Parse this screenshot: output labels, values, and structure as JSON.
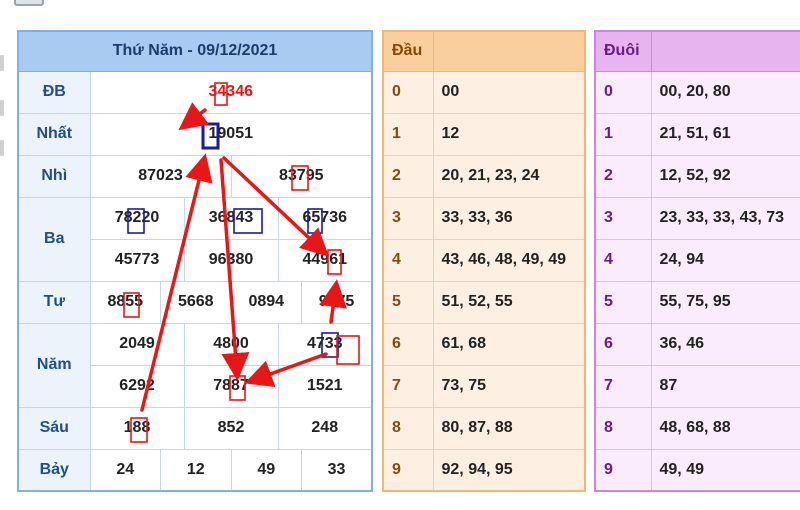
{
  "draw_date": "Thứ Năm - 09/12/2021",
  "prizes": {
    "db": {
      "label": "ĐB",
      "values": [
        "34346"
      ]
    },
    "nhat": {
      "label": "Nhất",
      "values": [
        "19051"
      ]
    },
    "nhi": {
      "label": "Nhì",
      "values": [
        "87023",
        "83795"
      ]
    },
    "ba": {
      "label": "Ba",
      "values": [
        "78220",
        "36843",
        "65736",
        "45773",
        "96380",
        "44961"
      ]
    },
    "tu": {
      "label": "Tư",
      "values": [
        "8855",
        "5668",
        "0894",
        "9375"
      ]
    },
    "nam": {
      "label": "Năm",
      "values": [
        "2049",
        "4800",
        "4733",
        "6292",
        "7887",
        "1521"
      ]
    },
    "sau": {
      "label": "Sáu",
      "values": [
        "188",
        "852",
        "248"
      ]
    },
    "bay": {
      "label": "Bảy",
      "values": [
        "24",
        "12",
        "49",
        "33"
      ]
    }
  },
  "dau": {
    "header_label": "Đầu",
    "rows": [
      {
        "key": "0",
        "value": "00"
      },
      {
        "key": "1",
        "value": "12"
      },
      {
        "key": "2",
        "value": "20, 21, 23, 24"
      },
      {
        "key": "3",
        "value": "33, 33, 36"
      },
      {
        "key": "4",
        "value": "43, 46, 48, 49, 49"
      },
      {
        "key": "5",
        "value": "51, 52, 55"
      },
      {
        "key": "6",
        "value": "61, 68"
      },
      {
        "key": "7",
        "value": "73, 75"
      },
      {
        "key": "8",
        "value": "80, 87, 88"
      },
      {
        "key": "9",
        "value": "92, 94, 95"
      }
    ]
  },
  "duoi": {
    "header_label": "Đuôi",
    "rows": [
      {
        "key": "0",
        "value": "00, 20, 80"
      },
      {
        "key": "1",
        "value": "21, 51, 61"
      },
      {
        "key": "2",
        "value": "12, 52, 92"
      },
      {
        "key": "3",
        "value": "23, 33, 33, 43, 73"
      },
      {
        "key": "4",
        "value": "24, 94"
      },
      {
        "key": "5",
        "value": "55, 75, 95"
      },
      {
        "key": "6",
        "value": "36, 46"
      },
      {
        "key": "7",
        "value": "87"
      },
      {
        "key": "8",
        "value": "48, 68, 88"
      },
      {
        "key": "9",
        "value": "49, 49"
      }
    ]
  },
  "colors": {
    "main_header": "#a9cbf2",
    "dau_header": "#f9cf9e",
    "duoi_header": "#e8b4f0",
    "special_prize": "#e81616",
    "annotation_red": "#e81616",
    "annotation_blue": "#1a1aa0"
  }
}
